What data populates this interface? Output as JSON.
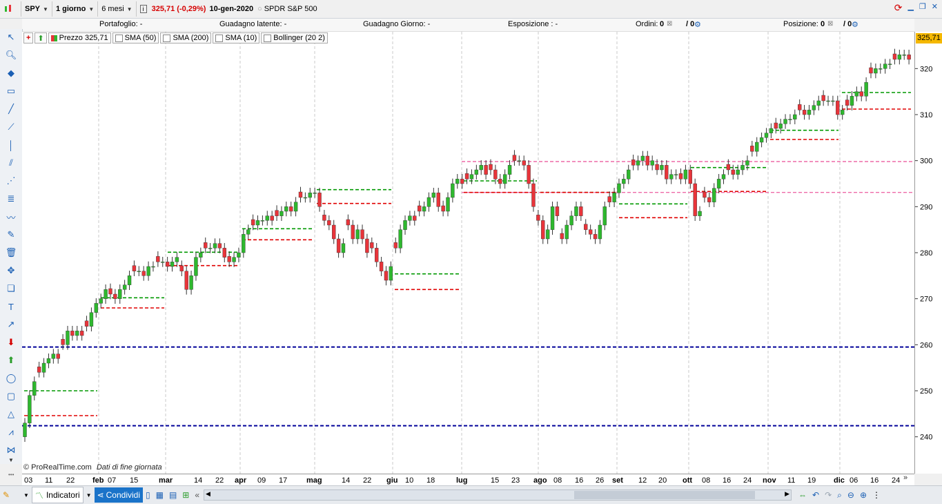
{
  "toolbar": {
    "symbol": "SPY",
    "timeframe": "1 giorno",
    "period": "6 mesi",
    "price_info": "325,71 (-0,29%)",
    "date": "10-gen-2020",
    "instrument": "SPDR S&P 500"
  },
  "status": {
    "portafoglio": "Portafoglio: -",
    "guadagno_latente": "Guadagno latente: -",
    "guadagno_giorno": "Guadagno Giorno: -",
    "esposizione": "Esposizione : -",
    "ordini_label": "Ordini:",
    "ordini_a": "0",
    "ordini_b": "/ 0",
    "posizione_label": "Posizione:",
    "posizione_a": "0",
    "posizione_b": "/ 0"
  },
  "legend": {
    "price": "Prezzo 325,71",
    "sma50": "SMA (50)",
    "sma200": "SMA (200)",
    "sma10": "SMA (10)",
    "bollinger": "Bollinger (20 2)"
  },
  "price_badge": "325,71",
  "copyright": "© ProRealTime.com",
  "data_note": "Dati di fine giornata",
  "bottom": {
    "indicators": "Indicatori",
    "share": "Condividi"
  },
  "colors": {
    "up": "#2eb82e",
    "down": "#e8343a",
    "green_line": "#009900",
    "red_line": "#e00000",
    "pink_line": "#ee6aa7",
    "navy_line": "#000099",
    "badge": "#f5b800"
  },
  "chart_data": {
    "type": "candlestick",
    "ylim": [
      232,
      328
    ],
    "y_ticks": [
      {
        "v": 240,
        "label": "240"
      },
      {
        "v": 250,
        "label": "250"
      },
      {
        "v": 260,
        "label": "260"
      },
      {
        "v": 270,
        "label": "270"
      },
      {
        "v": 280,
        "label": "280"
      },
      {
        "v": 290,
        "label": "290"
      },
      {
        "v": 300,
        "label": "300"
      },
      {
        "v": 310,
        "label": "310"
      },
      {
        "v": 320,
        "label": "320"
      }
    ],
    "x_labels": [
      {
        "t": "03",
        "bold": false
      },
      {
        "t": "11",
        "bold": false
      },
      {
        "t": "22",
        "bold": false
      },
      {
        "t": "feb",
        "bold": true
      },
      {
        "t": "07",
        "bold": false
      },
      {
        "t": "15",
        "bold": false
      },
      {
        "t": "mar",
        "bold": true
      },
      {
        "t": "14",
        "bold": false
      },
      {
        "t": "22",
        "bold": false
      },
      {
        "t": "apr",
        "bold": true
      },
      {
        "t": "09",
        "bold": false
      },
      {
        "t": "17",
        "bold": false
      },
      {
        "t": "mag",
        "bold": true
      },
      {
        "t": "14",
        "bold": false
      },
      {
        "t": "22",
        "bold": false
      },
      {
        "t": "giu",
        "bold": true
      },
      {
        "t": "10",
        "bold": false
      },
      {
        "t": "18",
        "bold": false
      },
      {
        "t": "lug",
        "bold": true
      },
      {
        "t": "15",
        "bold": false
      },
      {
        "t": "23",
        "bold": false
      },
      {
        "t": "ago",
        "bold": true
      },
      {
        "t": "08",
        "bold": false
      },
      {
        "t": "16",
        "bold": false
      },
      {
        "t": "26",
        "bold": false
      },
      {
        "t": "set",
        "bold": true
      },
      {
        "t": "12",
        "bold": false
      },
      {
        "t": "20",
        "bold": false
      },
      {
        "t": "ott",
        "bold": true
      },
      {
        "t": "08",
        "bold": false
      },
      {
        "t": "16",
        "bold": false
      },
      {
        "t": "24",
        "bold": false
      },
      {
        "t": "nov",
        "bold": true
      },
      {
        "t": "11",
        "bold": false
      },
      {
        "t": "19",
        "bold": false
      },
      {
        "t": "dic",
        "bold": true
      },
      {
        "t": "06",
        "bold": false
      },
      {
        "t": "16",
        "bold": false
      },
      {
        "t": "24",
        "bold": false
      }
    ],
    "monthly_levels": [
      {
        "month": "gen",
        "high": 250.0,
        "low": 244.6
      },
      {
        "month": "feb",
        "high": 270.2,
        "low": 268.0
      },
      {
        "month": "mar",
        "high": 280.1,
        "low": 277.2
      },
      {
        "month": "apr",
        "high": 285.2,
        "low": 282.8
      },
      {
        "month": "mag",
        "high": 293.7,
        "low": 290.7
      },
      {
        "month": "giu",
        "high": 275.4,
        "low": 272.0
      },
      {
        "month": "lug",
        "high": 295.6,
        "low": 293.1
      },
      {
        "month": "ago",
        "high": 293.1,
        "low": 293.1
      },
      {
        "month": "set",
        "high": 290.6,
        "low": 287.6
      },
      {
        "month": "ott",
        "high": 298.5,
        "low": 293.3
      },
      {
        "month": "nov",
        "high": 306.6,
        "low": 304.6
      },
      {
        "month": "dic",
        "high": 314.8,
        "low": 311.2
      }
    ],
    "long_levels": [
      {
        "kind": "navy",
        "v": 259.5
      },
      {
        "kind": "navy",
        "v": 242.4
      },
      {
        "kind": "pink",
        "v": 299.8
      },
      {
        "kind": "pink",
        "v": 293.1
      }
    ],
    "closes": [
      243,
      249,
      252,
      254,
      256,
      257,
      258,
      257,
      260,
      263,
      262,
      263,
      262,
      264,
      267,
      269,
      270,
      272,
      271,
      270,
      272,
      273,
      275,
      276,
      276,
      275,
      277,
      277,
      278,
      278,
      277,
      278,
      279,
      276,
      272,
      275,
      279,
      280,
      281,
      281,
      282,
      281,
      279,
      278,
      279,
      280,
      284,
      285,
      286,
      287,
      287,
      288,
      287,
      288,
      289,
      290,
      289,
      291,
      292,
      292,
      293,
      293,
      290,
      287,
      286,
      283,
      280,
      282,
      286,
      283,
      285,
      283,
      280,
      281,
      278,
      276,
      274,
      277,
      281,
      285,
      287,
      288,
      287,
      289,
      290,
      292,
      293,
      290,
      289,
      292,
      295,
      296,
      295,
      296,
      297,
      298,
      299,
      297,
      298,
      296,
      295,
      297,
      299,
      300,
      300,
      299,
      295,
      290,
      287,
      283,
      285,
      290,
      288,
      283,
      286,
      288,
      290,
      288,
      285,
      284,
      283,
      286,
      290,
      291,
      293,
      295,
      296,
      298,
      299,
      300,
      301,
      299,
      300,
      298,
      299,
      296,
      297,
      297,
      296,
      298,
      295,
      288,
      289,
      292,
      291,
      294,
      296,
      297,
      298,
      297,
      298,
      299,
      300,
      302,
      304,
      305,
      306,
      307,
      307,
      308,
      309,
      309,
      310,
      311,
      310,
      311,
      312,
      313,
      313,
      313,
      313,
      310,
      311,
      312,
      314,
      315,
      314,
      317,
      319,
      320,
      320,
      321,
      321,
      322,
      323,
      323,
      322
    ]
  }
}
